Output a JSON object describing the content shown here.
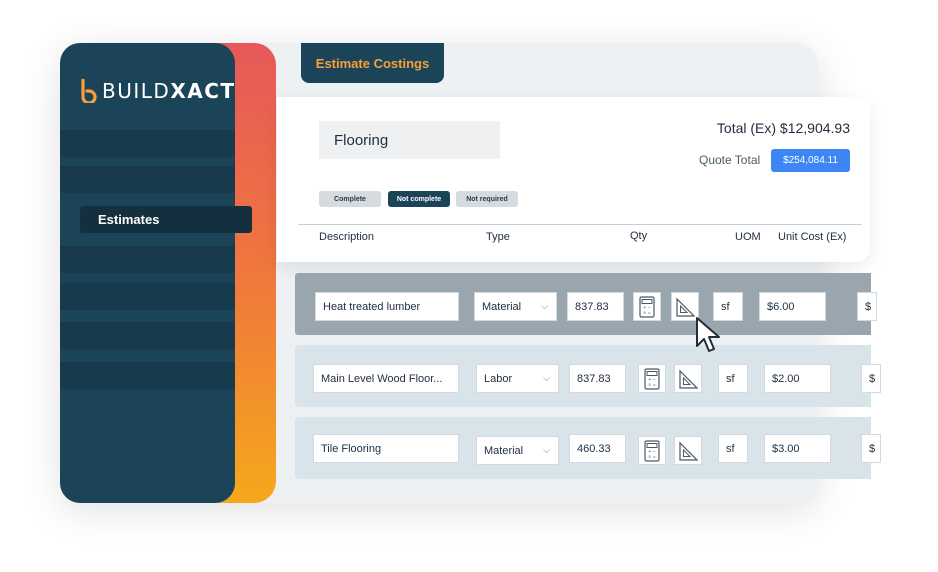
{
  "brand": {
    "word_light": "BUILD",
    "word_bold": "XACT",
    "logo_color": "#f5a03a"
  },
  "sidebar": {
    "active_item": "Estimates"
  },
  "tab": {
    "label": "Estimate Costings"
  },
  "header": {
    "stage_name": "Flooring",
    "total_ex": "Total (Ex) $12,904.93",
    "quote_total_label": "Quote Total",
    "quote_total_value": "$254,084.11",
    "status_pills": [
      "Complete",
      "Not complete",
      "Not required"
    ],
    "active_status": "Not complete"
  },
  "columns": [
    "Description",
    "Type",
    "Qty",
    "UOM",
    "Unit Cost (Ex)"
  ],
  "rows": [
    {
      "description": "Heat treated lumber",
      "type": "Material",
      "qty": "837.83",
      "uom": "sf",
      "unit_cost": "$6.00",
      "next": "$"
    },
    {
      "description": "Main Level Wood Floor...",
      "type": "Labor",
      "qty": "837.83",
      "uom": "sf",
      "unit_cost": "$2.00",
      "next": "$"
    },
    {
      "description": "Tile Flooring",
      "type": "Material",
      "qty": "460.33",
      "uom": "sf",
      "unit_cost": "$3.00",
      "next": "$"
    }
  ],
  "icons": {
    "calculator": "calculator-icon",
    "takeoff": "set-square-icon",
    "dropdown": "chevron-down-icon",
    "cursor": "mouse-pointer-icon"
  },
  "colors": {
    "sidebar": "#1c4458",
    "accent_orange": "#f5a03a",
    "primary_blue": "#3d86f4",
    "row_selected": "#9aa6ad",
    "row_normal": "#d9e4ea"
  }
}
